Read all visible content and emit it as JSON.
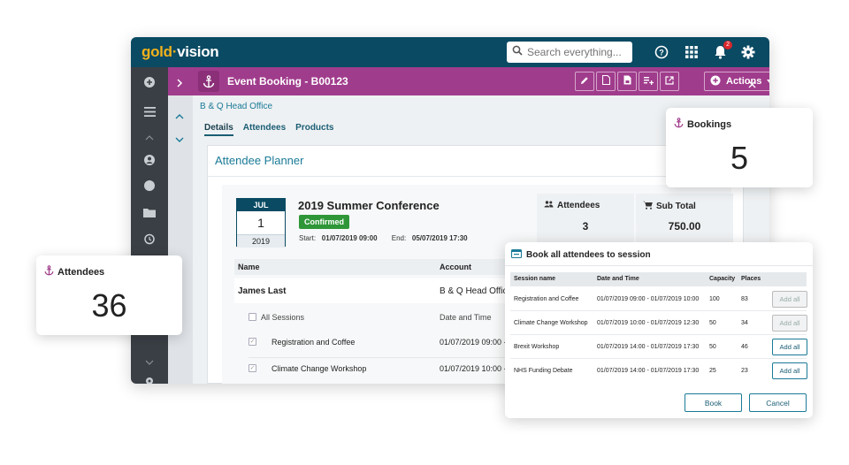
{
  "app": {
    "logo_gold": "gold",
    "logo_dot": "·",
    "logo_vision": "vision",
    "search_placeholder": "Search everything...",
    "notification_count": "2"
  },
  "record": {
    "title": "Event Booking - B00123",
    "actions_label": "Actions",
    "account": "B & Q Head Office",
    "tabs": [
      "Details",
      "Attendees",
      "Products"
    ]
  },
  "planner": {
    "title": "Attendee Planner",
    "event": {
      "month": "JUL",
      "day": "1",
      "year": "2019",
      "name": "2019 Summer Conference",
      "status": "Confirmed",
      "start_label": "Start:",
      "start": "01/07/2019 09:00",
      "end_label": "End:",
      "end": "05/07/2019 17:30"
    },
    "stats": {
      "attendees_label": "Attendees",
      "attendees_value": "3",
      "subtotal_label": "Sub Total",
      "subtotal_value": "750.00"
    },
    "table": {
      "col_name": "Name",
      "col_account": "Account",
      "attendee_name": "James Last",
      "attendee_account": "B & Q Head Office",
      "all_sessions": "All Sessions",
      "date_time": "Date and Time",
      "sessions": [
        {
          "name": "Registration and Coffee",
          "datetime": "01/07/2019 09:00 -"
        },
        {
          "name": "Climate Change Workshop",
          "datetime": "01/07/2019 10:00 -"
        }
      ]
    }
  },
  "cards": {
    "bookings_label": "Bookings",
    "bookings_value": "5",
    "attendees_label": "Attendees",
    "attendees_value": "36"
  },
  "modal": {
    "title": "Book all attendees to session",
    "headers": [
      "Session name",
      "Date and Time",
      "Capacity",
      "Places"
    ],
    "rows": [
      {
        "name": "Registration and Coffee",
        "datetime": "01/07/2019 09:00 - 01/07/2019 10:00",
        "capacity": "100",
        "places": "83",
        "button": "Add all"
      },
      {
        "name": "Climate Change Workshop",
        "datetime": "01/07/2019 10:00 - 01/07/2019 12:30",
        "capacity": "50",
        "places": "34",
        "button": "Add all"
      },
      {
        "name": "Brexit Workshop",
        "datetime": "01/07/2019 14:00 - 01/07/2019 17:30",
        "capacity": "50",
        "places": "46",
        "button": "Add all"
      },
      {
        "name": "NHS Funding Debate",
        "datetime": "01/07/2019 14:00 - 01/07/2019 17:30",
        "capacity": "25",
        "places": "23",
        "button": "Add all"
      }
    ],
    "book_label": "Book",
    "cancel_label": "Cancel"
  },
  "colors": {
    "topbar": "#0a4a63",
    "record_bar": "#a03c8c",
    "accent": "#1a7a97",
    "confirmed": "#2f9638",
    "logo_gold": "#f2b21b"
  },
  "icons": [
    "search-icon",
    "help-icon",
    "apps-grid-icon",
    "bell-icon",
    "gear-icon",
    "anchor-icon",
    "people-icon",
    "cart-icon",
    "calendar-add-icon"
  ]
}
